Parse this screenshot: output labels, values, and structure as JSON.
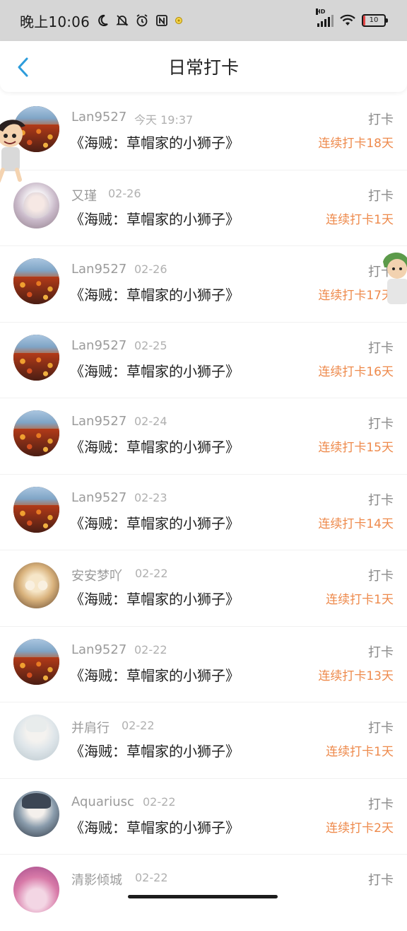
{
  "status_bar": {
    "time": "晚上10:06",
    "hd_label": "HD",
    "battery": "10",
    "icons": [
      "moon-icon",
      "bell-off-icon",
      "alarm-icon",
      "nfc-icon",
      "notification-icon",
      "signal-icon",
      "wifi-icon",
      "battery-icon"
    ]
  },
  "header": {
    "title": "日常打卡",
    "back_icon": "chevron-left-icon",
    "accent_color": "#2d9cdb"
  },
  "colors": {
    "streak": "#ee8a4c",
    "username": "#9b9b9b",
    "book": "#222222"
  },
  "items": [
    {
      "username": "Lan9527",
      "time": "今天 19:37",
      "book": "《海贼：草帽家的小狮子》",
      "action": "打卡",
      "streak": "连续打卡18天",
      "avatar": "flowers"
    },
    {
      "username": "又瑾",
      "time": "02-26",
      "book": "《海贼：草帽家的小狮子》",
      "action": "打卡",
      "streak": "连续打卡1天",
      "avatar": "girl-white"
    },
    {
      "username": "Lan9527",
      "time": "02-26",
      "book": "《海贼：草帽家的小狮子》",
      "action": "打卡",
      "streak": "连续打卡17天",
      "avatar": "flowers"
    },
    {
      "username": "Lan9527",
      "time": "02-25",
      "book": "《海贼：草帽家的小狮子》",
      "action": "打卡",
      "streak": "连续打卡16天",
      "avatar": "flowers"
    },
    {
      "username": "Lan9527",
      "time": "02-24",
      "book": "《海贼：草帽家的小狮子》",
      "action": "打卡",
      "streak": "连续打卡15天",
      "avatar": "flowers"
    },
    {
      "username": "Lan9527",
      "time": "02-23",
      "book": "《海贼：草帽家的小狮子》",
      "action": "打卡",
      "streak": "连续打卡14天",
      "avatar": "flowers"
    },
    {
      "username": "安安梦吖",
      "time": "02-22",
      "book": "《海贼：草帽家的小狮子》",
      "action": "打卡",
      "streak": "连续打卡1天",
      "avatar": "anime-gold"
    },
    {
      "username": "Lan9527",
      "time": "02-22",
      "book": "《海贼：草帽家的小狮子》",
      "action": "打卡",
      "streak": "连续打卡13天",
      "avatar": "flowers"
    },
    {
      "username": "并肩行",
      "time": "02-22",
      "book": "《海贼：草帽家的小狮子》",
      "action": "打卡",
      "streak": "连续打卡1天",
      "avatar": "pale-boy"
    },
    {
      "username": "Aquariusc",
      "time": "02-22",
      "book": "《海贼：草帽家的小狮子》",
      "action": "打卡",
      "streak": "连续打卡2天",
      "avatar": "anime-dark"
    },
    {
      "username": "清影倾城",
      "time": "02-22",
      "book": "",
      "action": "打卡",
      "streak": "",
      "avatar": "pink"
    }
  ]
}
